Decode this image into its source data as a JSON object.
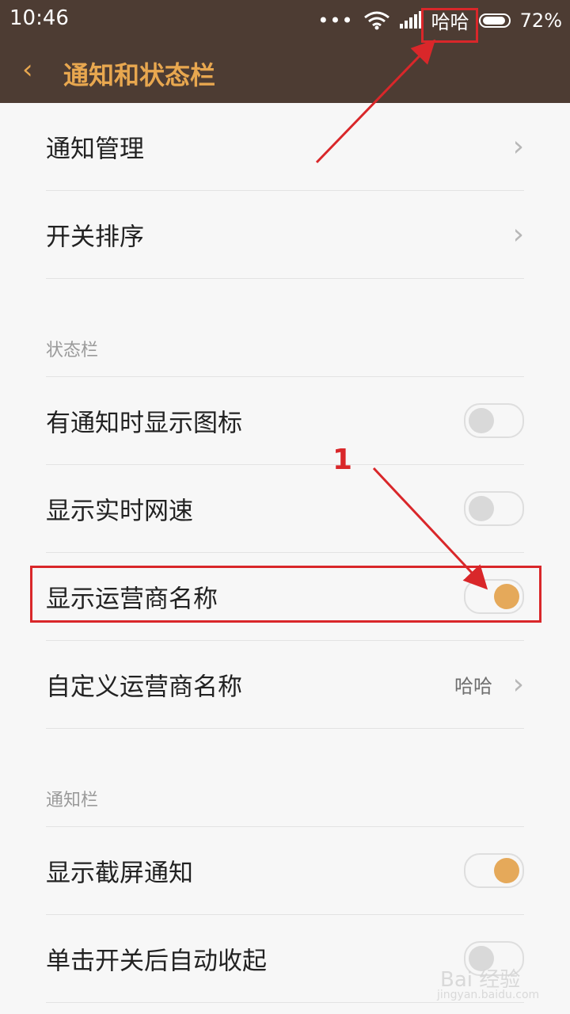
{
  "statusbar": {
    "time": "10:46",
    "carrier": "哈哈",
    "battery_percent": "72%",
    "icons": [
      "more-dots-icon",
      "wifi-icon",
      "signal-icon",
      "battery-icon"
    ]
  },
  "header": {
    "back_icon": "chevron-left-icon",
    "title": "通知和状态栏"
  },
  "items": {
    "notify_mgmt": "通知管理",
    "switch_sort": "开关排序"
  },
  "sections": {
    "statusbar": "状态栏",
    "notifybar": "通知栏"
  },
  "statusbar_settings": {
    "show_icon_label": "有通知时显示图标",
    "show_speed_label": "显示实时网速",
    "show_carrier_label": "显示运营商名称",
    "custom_carrier_label": "自定义运营商名称",
    "custom_carrier_value": "哈哈"
  },
  "notifybar_settings": {
    "screenshot_label": "显示截屏通知",
    "collapse_label": "单击开关后自动收起"
  },
  "toggles": {
    "show_icon": false,
    "show_speed": false,
    "show_carrier": true,
    "screenshot": true,
    "collapse": false
  },
  "annotation": {
    "step": "1"
  },
  "watermark": {
    "line1": "Bai 经验",
    "line2": "jingyan.baidu.com"
  },
  "colors": {
    "header_bg": "#4d3c33",
    "accent": "#e8a74f",
    "annotation_red": "#d9272a"
  }
}
